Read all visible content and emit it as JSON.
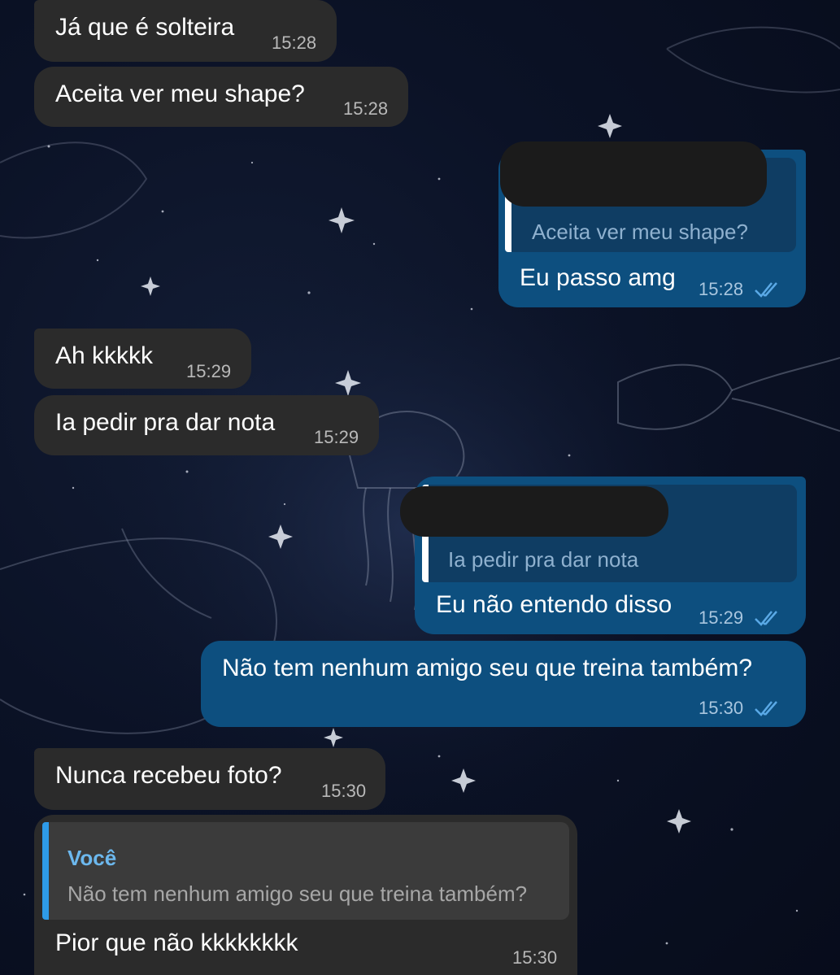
{
  "messages": [
    {
      "direction": "incoming",
      "text": "Já que é solteira",
      "time": "15:28"
    },
    {
      "direction": "incoming",
      "text": "Aceita ver meu shape?",
      "time": "15:28"
    },
    {
      "direction": "outgoing",
      "reply_quote": "Aceita ver meu shape?",
      "reply_sender_redacted": true,
      "text": "Eu passo amg",
      "time": "15:28",
      "read_receipt": "double-check-icon"
    },
    {
      "direction": "incoming",
      "text": "Ah kkkkk",
      "time": "15:29"
    },
    {
      "direction": "incoming",
      "text": "Ia pedir pra dar nota",
      "time": "15:29"
    },
    {
      "direction": "outgoing",
      "reply_quote": "Ia pedir pra dar nota",
      "reply_sender_redacted": true,
      "text": "Eu não entendo disso",
      "time": "15:29",
      "read_receipt": "double-check-icon"
    },
    {
      "direction": "outgoing",
      "text": "Não tem nenhum amigo seu que treina também?",
      "time": "15:30",
      "read_receipt": "double-check-icon"
    },
    {
      "direction": "incoming",
      "text": "Nunca recebeu foto?",
      "time": "15:30"
    },
    {
      "direction": "incoming",
      "reply_sender": "Você",
      "reply_quote": "Não tem nenhum amigo seu que treina também?",
      "text": "Pior que não kkkkkkkk",
      "time": "15:30"
    }
  ],
  "colors": {
    "incoming_bubble": "#2b2b2b",
    "outgoing_bubble": "#0d4f7f",
    "reply_accent": "#2e9be8",
    "background": "#0b1226"
  }
}
